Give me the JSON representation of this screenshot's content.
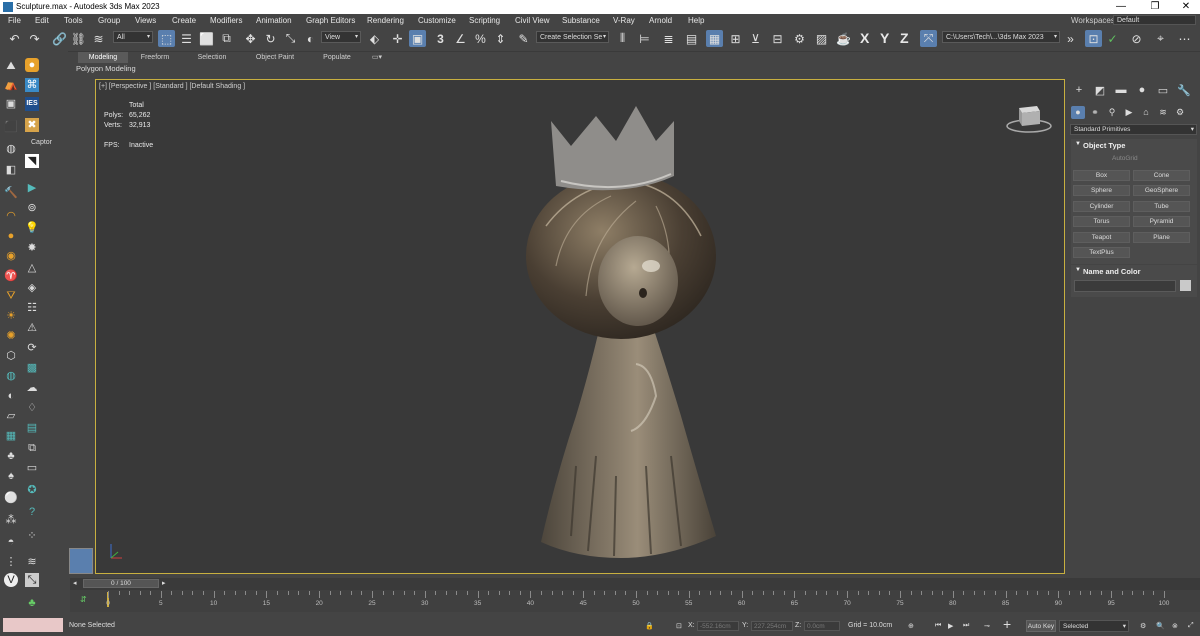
{
  "window": {
    "title": "Sculpture.max - Autodesk 3ds Max 2023",
    "controls": [
      "—",
      "❐",
      "✕"
    ]
  },
  "menu": {
    "items": [
      "File",
      "Edit",
      "Tools",
      "Group",
      "Views",
      "Create",
      "Modifiers",
      "Animation",
      "Graph Editors",
      "Rendering",
      "Customize",
      "Scripting",
      "Civil View",
      "Substance",
      "V-Ray",
      "Arnold",
      "Help"
    ],
    "workspaces_label": "Workspaces:",
    "workspaces_value": "Default"
  },
  "toolbar": {
    "filter_value": "All",
    "refcoord_value": "View",
    "selection_set_placeholder": "Create Selection Se",
    "path_value": "C:\\Users\\Tech\\...\\3ds Max 2023",
    "axis_labels": [
      "X",
      "Y",
      "Z"
    ],
    "snap_label": "3",
    "icons": [
      "undo-icon",
      "redo-icon",
      "link-icon",
      "unlink-icon",
      "bind-space-warp-icon",
      "select-object-icon",
      "select-by-name-icon",
      "rectangular-selection-icon",
      "window-crossing-icon",
      "move-icon",
      "rotate-icon",
      "scale-icon",
      "placement-icon",
      "pivot-icon",
      "keyboard-shortcut-icon",
      "snaps-toggle-icon",
      "angle-snap-icon",
      "percent-snap-icon",
      "spinner-snap-icon",
      "edit-named-selection-icon",
      "mirror-icon",
      "align-icon",
      "layer-explorer-icon",
      "ribbon-icon",
      "scene-explorer-icon",
      "curve-editor-icon",
      "schematic-view-icon",
      "material-editor-icon",
      "render-setup-icon",
      "rendered-frame-icon",
      "render-icon"
    ]
  },
  "ribbon": {
    "tabs": [
      "Modeling",
      "Freeform",
      "Selection",
      "Object Paint",
      "Populate"
    ],
    "active_tab": "Modeling",
    "panel_label": "Polygon Modeling"
  },
  "left_panel": {
    "tooltip": "Captor",
    "badge": "IES"
  },
  "viewport": {
    "label": "[+] [Perspective ] [Standard ] [Default Shading ]",
    "stats": {
      "total_label": "Total",
      "polys_label": "Polys:",
      "polys_value": "65,262",
      "verts_label": "Verts:",
      "verts_value": "32,913",
      "fps_label": "FPS:",
      "fps_value": "Inactive"
    },
    "border_color": "#c8b040",
    "model_color": "#7d7160"
  },
  "command_panel": {
    "category_value": "Standard Primitives",
    "object_type_title": "Object Type",
    "autogrid_label": "AutoGrid",
    "buttons": [
      "Box",
      "Cone",
      "Sphere",
      "GeoSphere",
      "Cylinder",
      "Tube",
      "Torus",
      "Pyramid",
      "Teapot",
      "Plane",
      "TextPlus"
    ],
    "name_color_title": "Name and Color"
  },
  "timeline": {
    "slider_label": "0 / 100",
    "ticks": [
      "0",
      "5",
      "10",
      "15",
      "20",
      "25",
      "30",
      "35",
      "40",
      "45",
      "50",
      "55",
      "60",
      "65",
      "70",
      "75",
      "80",
      "85",
      "90",
      "95",
      "100"
    ]
  },
  "status": {
    "selection_message": "None Selected",
    "x_label": "X:",
    "x_value": "-552.16cm",
    "y_label": "Y:",
    "y_value": "227.254cm",
    "z_label": "Z:",
    "z_value": "0.0cm",
    "grid_label": "Grid = 10.0cm",
    "autokey_label": "Auto Key",
    "selected_value": "Selected"
  }
}
